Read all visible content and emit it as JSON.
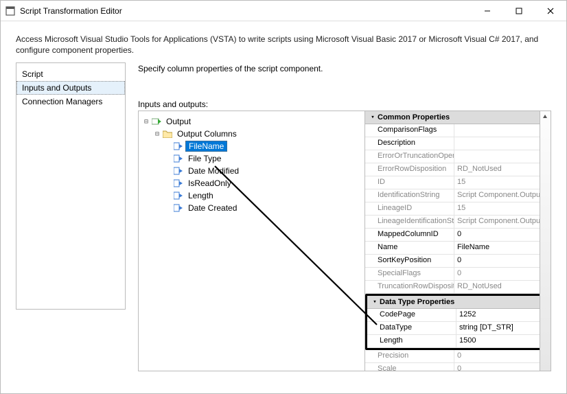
{
  "window": {
    "title": "Script Transformation Editor",
    "intro": "Access Microsoft Visual Studio Tools for Applications (VSTA) to write scripts using Microsoft Visual Basic 2017 or Microsoft Visual C# 2017, and configure component properties."
  },
  "nav": {
    "items": [
      {
        "label": "Script"
      },
      {
        "label": "Inputs and Outputs"
      },
      {
        "label": "Connection Managers"
      }
    ],
    "selected": 1
  },
  "rightpane": {
    "spec_label": "Specify column properties of the script component.",
    "io_label": "Inputs and outputs:"
  },
  "tree": {
    "root": {
      "label": "Output"
    },
    "columns_node": {
      "label": "Output Columns"
    },
    "columns": [
      {
        "label": "FileName",
        "selected": true
      },
      {
        "label": "File Type"
      },
      {
        "label": "Date Modified"
      },
      {
        "label": "IsReadOnly"
      },
      {
        "label": "Length"
      },
      {
        "label": "Date Created"
      }
    ]
  },
  "propgrid": {
    "group_common": "Common Properties",
    "group_datatype": "Data Type Properties",
    "common": [
      {
        "key": "ComparisonFlags",
        "val": "",
        "readonly": false
      },
      {
        "key": "Description",
        "val": "",
        "readonly": false
      },
      {
        "key": "ErrorOrTruncationOperation",
        "val": "",
        "readonly": true
      },
      {
        "key": "ErrorRowDisposition",
        "val": "RD_NotUsed",
        "readonly": true
      },
      {
        "key": "ID",
        "val": "15",
        "readonly": true
      },
      {
        "key": "IdentificationString",
        "val": "Script Component.Outputs",
        "readonly": true
      },
      {
        "key": "LineageID",
        "val": "15",
        "readonly": true
      },
      {
        "key": "LineageIdentificationString",
        "val": "Script Component.Outputs",
        "readonly": true
      },
      {
        "key": "MappedColumnID",
        "val": "0",
        "readonly": false
      },
      {
        "key": "Name",
        "val": "FileName",
        "readonly": false
      },
      {
        "key": "SortKeyPosition",
        "val": "0",
        "readonly": false
      },
      {
        "key": "SpecialFlags",
        "val": "0",
        "readonly": true
      },
      {
        "key": "TruncationRowDisposition",
        "val": "RD_NotUsed",
        "readonly": true
      }
    ],
    "datatype": [
      {
        "key": "CodePage",
        "val": "1252",
        "readonly": false
      },
      {
        "key": "DataType",
        "val": "string [DT_STR]",
        "readonly": false
      },
      {
        "key": "Length",
        "val": "1500",
        "readonly": false
      }
    ],
    "tail": [
      {
        "key": "Precision",
        "val": "0",
        "readonly": true
      },
      {
        "key": "Scale",
        "val": "0",
        "readonly": true
      }
    ]
  }
}
